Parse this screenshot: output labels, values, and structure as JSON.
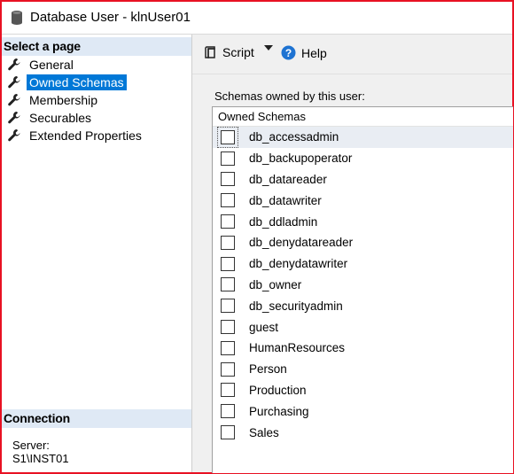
{
  "window": {
    "title": "Database User - klnUser01"
  },
  "left_pane": {
    "select_page_header": "Select a page",
    "pages": [
      {
        "label": "General"
      },
      {
        "label": "Owned Schemas"
      },
      {
        "label": "Membership"
      },
      {
        "label": "Securables"
      },
      {
        "label": "Extended Properties"
      }
    ],
    "connection_header": "Connection",
    "server_label": "Server:",
    "server_value": "S1\\INST01"
  },
  "toolbar": {
    "script_label": "Script",
    "help_label": "Help"
  },
  "owned_schemas": {
    "caption": "Schemas owned by this user:",
    "column_header": "Owned Schemas",
    "rows": [
      {
        "name": "db_accessadmin",
        "checked": false
      },
      {
        "name": "db_backupoperator",
        "checked": false
      },
      {
        "name": "db_datareader",
        "checked": false
      },
      {
        "name": "db_datawriter",
        "checked": false
      },
      {
        "name": "db_ddladmin",
        "checked": false
      },
      {
        "name": "db_denydatareader",
        "checked": false
      },
      {
        "name": "db_denydatawriter",
        "checked": false
      },
      {
        "name": "db_owner",
        "checked": false
      },
      {
        "name": "db_securityadmin",
        "checked": false
      },
      {
        "name": "guest",
        "checked": false
      },
      {
        "name": "HumanResources",
        "checked": false
      },
      {
        "name": "Person",
        "checked": false
      },
      {
        "name": "Production",
        "checked": false
      },
      {
        "name": "Purchasing",
        "checked": false
      },
      {
        "name": "Sales",
        "checked": false
      }
    ]
  },
  "colors": {
    "selection": "#0078d7",
    "section_header": "#dfe9f5",
    "border": "#e81123"
  }
}
